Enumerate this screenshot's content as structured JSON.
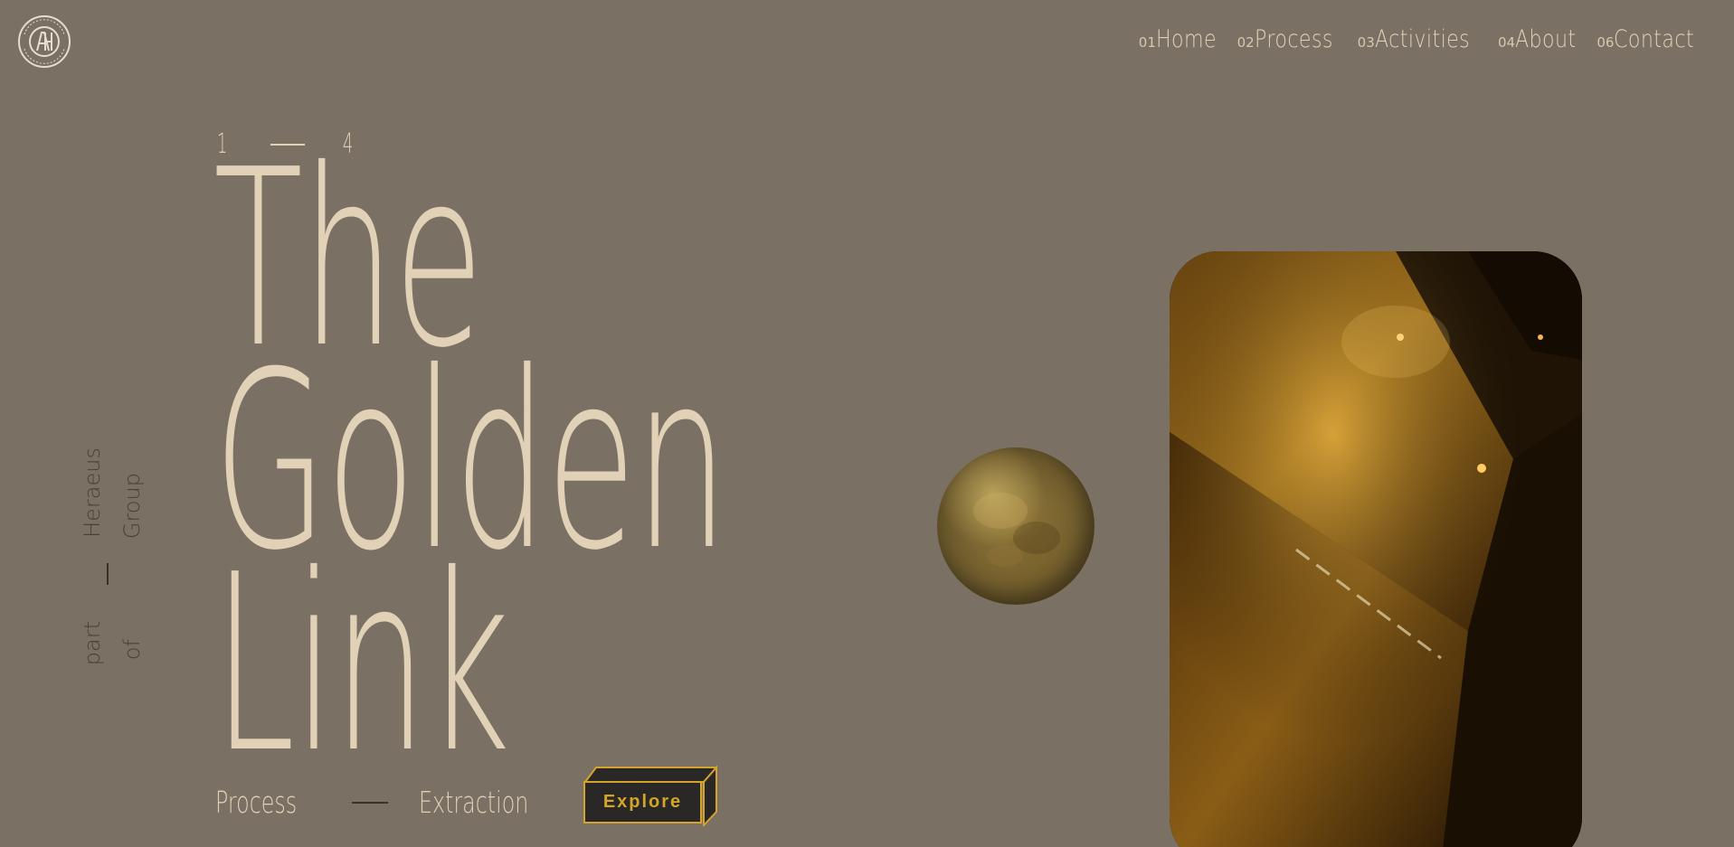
{
  "brand": {
    "logo_alt": "Argor-Heraeus SA logo",
    "logo_ring_text": "ARGOR · HERAEUS SA",
    "logo_monogram": "AH"
  },
  "nav": {
    "items": [
      {
        "num": "01",
        "label": "Home"
      },
      {
        "num": "02",
        "label": "Process"
      },
      {
        "num": "03",
        "label": "Activities"
      },
      {
        "num": "04",
        "label": "About"
      },
      {
        "num": "06",
        "label": "Contact"
      }
    ]
  },
  "slider": {
    "current": "1",
    "total": "4"
  },
  "hero": {
    "title_lines": [
      "The",
      "Golden",
      "Link"
    ],
    "subtitle_left": "Process",
    "subtitle_right": "Extraction",
    "cta_label": "Explore"
  },
  "side_text": {
    "col1": "part",
    "col2": "of",
    "col3": "Heraeus",
    "col4": "Group"
  },
  "colors": {
    "background": "#7b7064",
    "text_cream": "#e0d1b7",
    "accent_gold": "#d4a52a",
    "button_dark": "#2a2827"
  }
}
